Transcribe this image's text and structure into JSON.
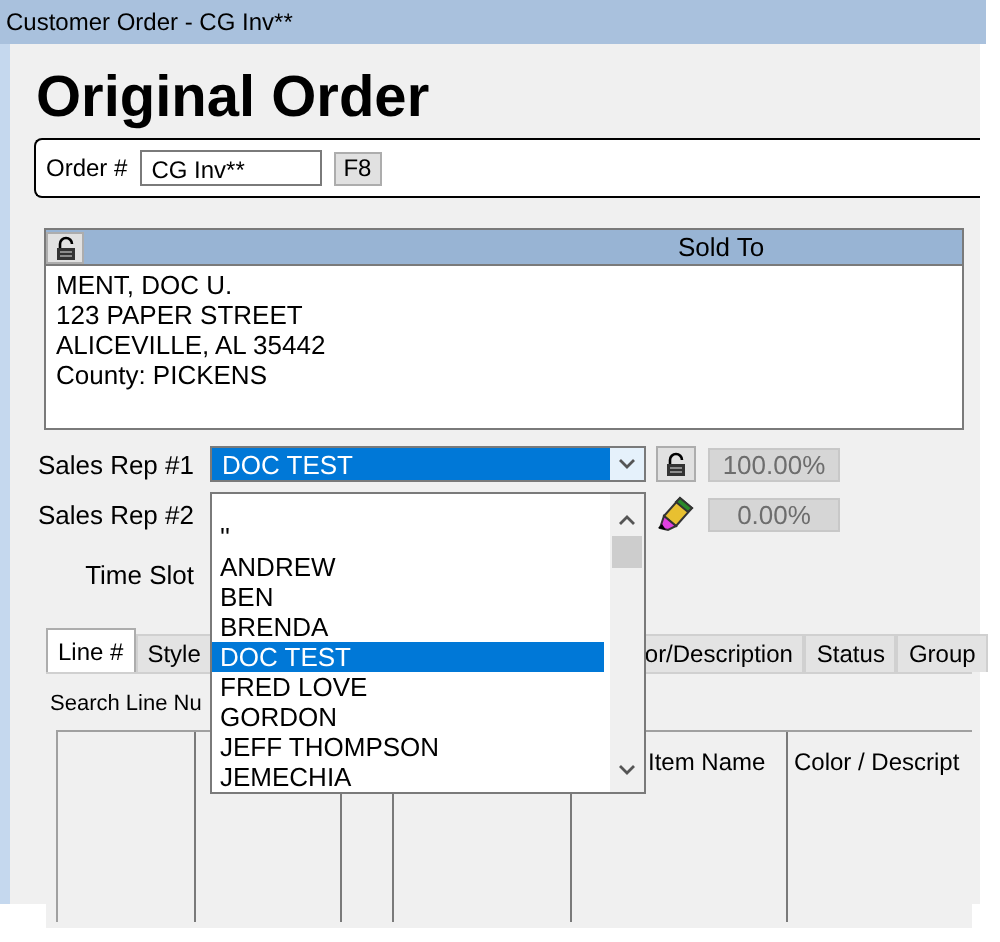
{
  "window": {
    "title": "Customer Order - CG Inv**"
  },
  "heading": "Original Order",
  "order": {
    "label": "Order #",
    "value": "CG Inv**",
    "button": "F8"
  },
  "sold_to": {
    "title": "Sold To",
    "lines": [
      "MENT, DOC U.",
      "123 PAPER STREET",
      "ALICEVILLE, AL  35442",
      "County: PICKENS"
    ]
  },
  "sales_reps": [
    {
      "kind": "locked",
      "label": "Sales Rep #1",
      "value": "DOC TEST",
      "percent": "100.00%"
    },
    {
      "kind": "edit",
      "label": "Sales Rep #2",
      "percent": "0.00%"
    }
  ],
  "time_slot": {
    "label": "Time Slot"
  },
  "tabs": [
    {
      "label": "Line #",
      "selected": true
    },
    {
      "label": "Style",
      "selected": false
    },
    {
      "label": "or/Description",
      "selected": false
    },
    {
      "label": "Status",
      "selected": false
    },
    {
      "label": "Group",
      "selected": false
    }
  ],
  "search_label": "Search Line Nu",
  "grid": {
    "columns": [
      {
        "label": "Item Name"
      },
      {
        "label": "Color / Descript"
      }
    ]
  },
  "dropdown": {
    "options": [
      {
        "label": "''",
        "selected": false
      },
      {
        "label": "ANDREW",
        "selected": false
      },
      {
        "label": "BEN",
        "selected": false
      },
      {
        "label": "BRENDA",
        "selected": false
      },
      {
        "label": "DOC TEST",
        "selected": true
      },
      {
        "label": "FRED LOVE",
        "selected": false
      },
      {
        "label": "GORDON",
        "selected": false
      },
      {
        "label": "JEFF THOMPSON",
        "selected": false
      },
      {
        "label": "JEMECHIA",
        "selected": false
      }
    ]
  }
}
